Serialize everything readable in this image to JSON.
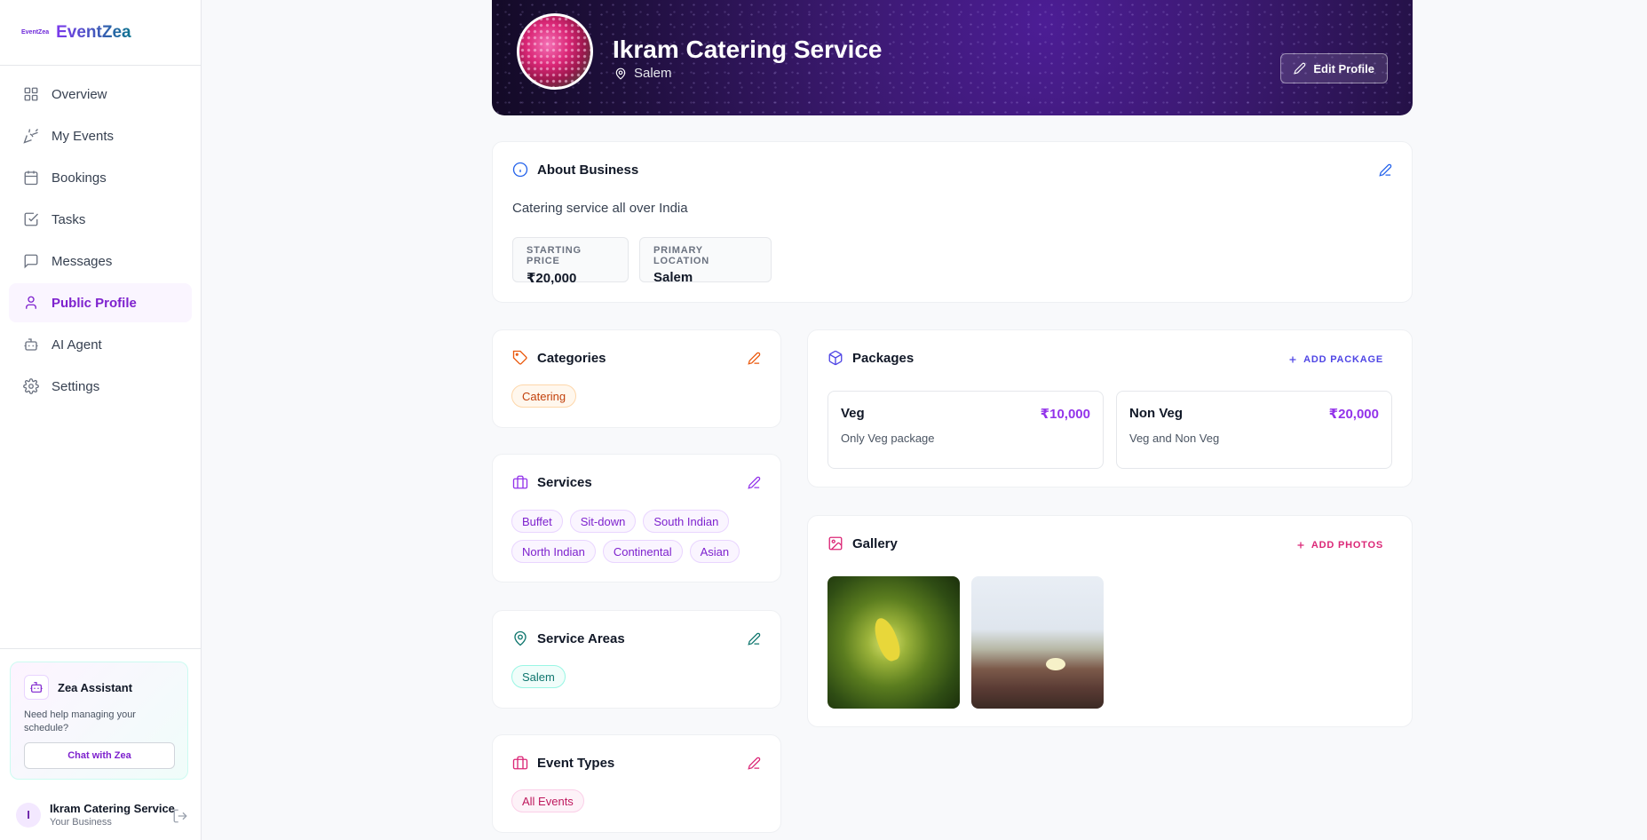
{
  "brand": {
    "mini": "EventZea",
    "name": "EventZea"
  },
  "nav": [
    {
      "label": "Overview",
      "icon": "grid-icon"
    },
    {
      "label": "My Events",
      "icon": "party-popper-icon"
    },
    {
      "label": "Bookings",
      "icon": "calendar-icon"
    },
    {
      "label": "Tasks",
      "icon": "check-square-icon"
    },
    {
      "label": "Messages",
      "icon": "message-square-icon"
    },
    {
      "label": "Public Profile",
      "icon": "user-icon",
      "active": true
    },
    {
      "label": "AI Agent",
      "icon": "bot-icon"
    },
    {
      "label": "Settings",
      "icon": "gear-icon"
    }
  ],
  "assistant": {
    "title": "Zea Assistant",
    "text": "Need help managing your schedule?",
    "button": "Chat with Zea"
  },
  "user": {
    "initial": "I",
    "name": "Ikram Catering Service",
    "role": "Your Business"
  },
  "hero": {
    "name": "Ikram Catering Service",
    "location": "Salem",
    "edit_label": "Edit Profile"
  },
  "about": {
    "title": "About Business",
    "description": "Catering service all over India",
    "starting_price_label": "STARTING PRICE",
    "starting_price": "₹20,000",
    "primary_location_label": "PRIMARY LOCATION",
    "primary_location": "Salem"
  },
  "categories": {
    "title": "Categories",
    "items": [
      "Catering"
    ]
  },
  "services": {
    "title": "Services",
    "items": [
      "Buffet",
      "Sit-down",
      "South Indian",
      "North Indian",
      "Continental",
      "Asian"
    ]
  },
  "service_areas": {
    "title": "Service Areas",
    "items": [
      "Salem"
    ]
  },
  "event_types": {
    "title": "Event Types",
    "items": [
      "All Events"
    ]
  },
  "packages": {
    "title": "Packages",
    "add_label": "ADD PACKAGE",
    "items": [
      {
        "name": "Veg",
        "price": "₹10,000",
        "desc": "Only Veg package"
      },
      {
        "name": "Non Veg",
        "price": "₹20,000",
        "desc": "Veg and Non Veg"
      }
    ]
  },
  "gallery": {
    "title": "Gallery",
    "add_label": "ADD PHOTOS"
  },
  "colors": {
    "accent": "#7e22ce",
    "hero_bg": "#2e1065",
    "orange": "#ea580c",
    "teal": "#0f766e",
    "pink": "#db2777"
  }
}
